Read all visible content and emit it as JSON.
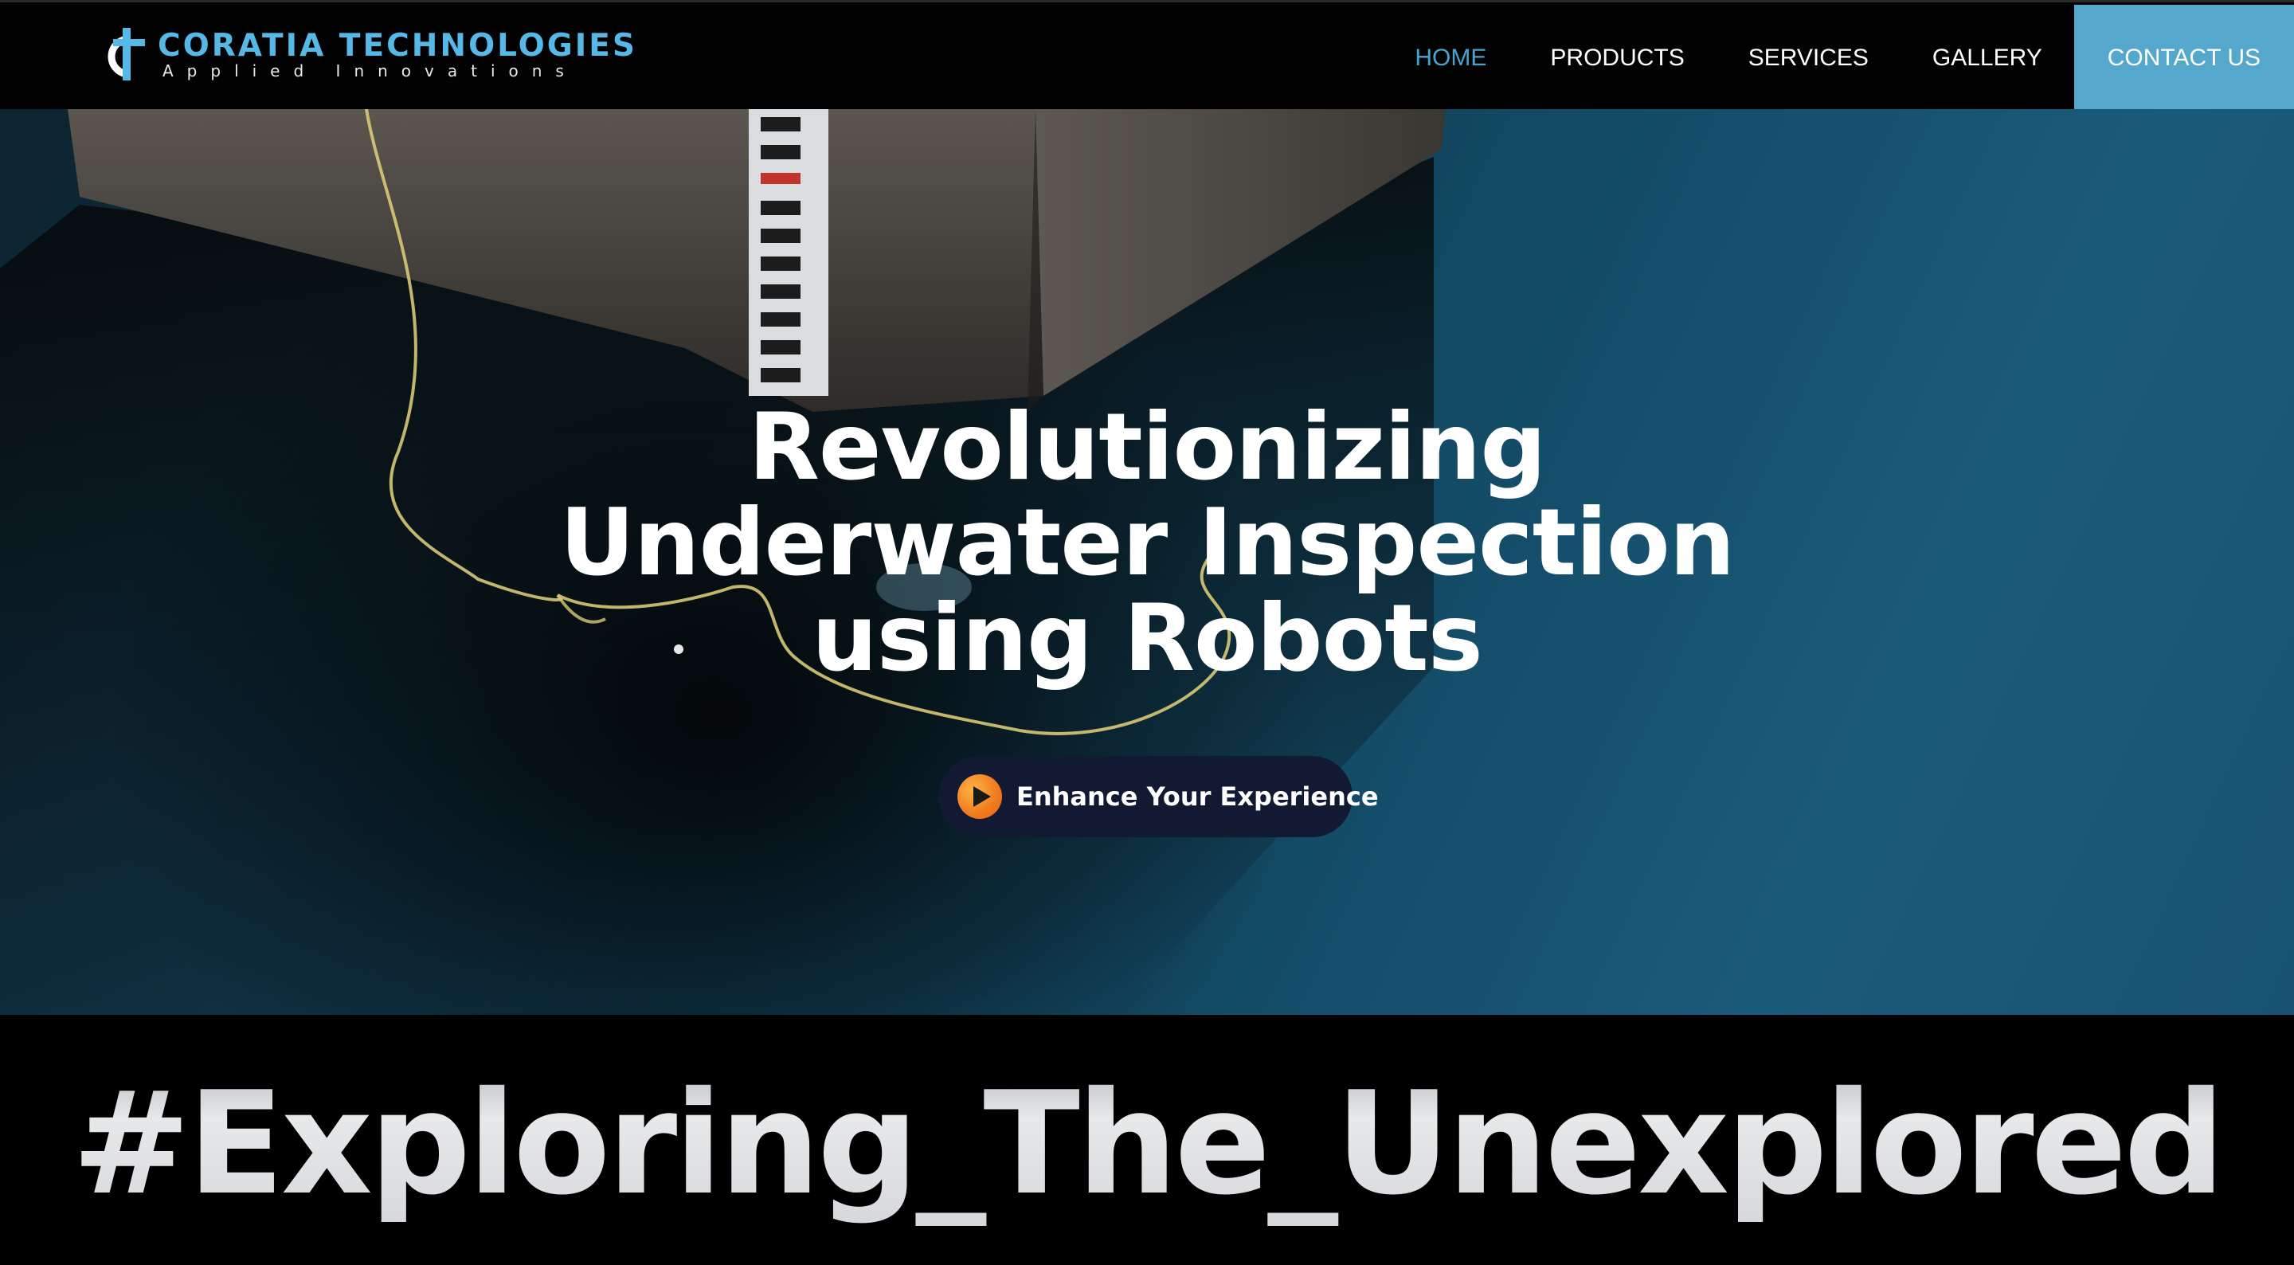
{
  "brand": {
    "name": "CORATIA TECHNOLOGIES",
    "tagline": "Applied Innovations",
    "accent_color": "#55b8e6"
  },
  "nav": {
    "items": [
      {
        "label": "HOME",
        "active": true
      },
      {
        "label": "PRODUCTS",
        "active": false
      },
      {
        "label": "SERVICES",
        "active": false
      },
      {
        "label": "GALLERY",
        "active": false
      }
    ],
    "cta_label": "CONTACT US",
    "cta_color": "#55a8cc",
    "active_color": "#4aa3cf"
  },
  "hero": {
    "title_lines": [
      "Revolutionizing",
      "Underwater Inspection",
      "using Robots"
    ],
    "button_icon": "play-icon",
    "button_label": "Enhance Your Experience",
    "background_water_color": "#134b66"
  },
  "banner": {
    "hashtag": "#Exploring_The_Unexplored"
  }
}
